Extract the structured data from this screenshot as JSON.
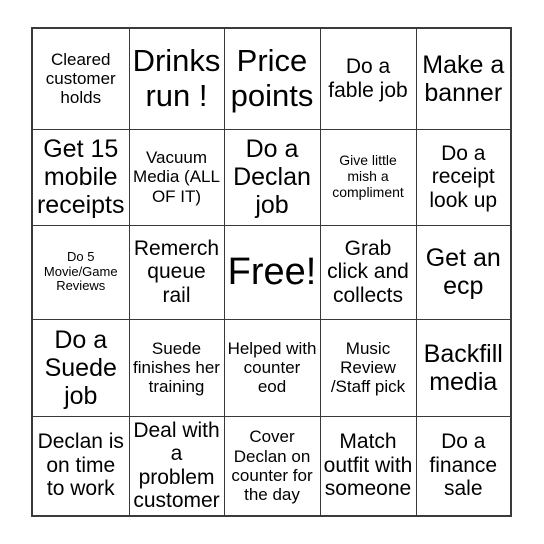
{
  "card": {
    "type": "bingo-card",
    "rows": 5,
    "columns": 5,
    "free_space": {
      "row": 2,
      "column": 2,
      "label": "Free!"
    },
    "background_color": "#ffffff",
    "border_color": "#3a3a3a",
    "text_color": "#000000",
    "cells": [
      [
        {
          "text": "Cleared customer holds",
          "size": "sm"
        },
        {
          "text": "Drinks run !",
          "size": "xl"
        },
        {
          "text": "Price points",
          "size": "xl"
        },
        {
          "text": "Do a fable job",
          "size": "md"
        },
        {
          "text": "Make a banner",
          "size": "lg"
        }
      ],
      [
        {
          "text": "Get 15 mobile receipts",
          "size": "lg"
        },
        {
          "text": "Vacuum Media (ALL OF IT)",
          "size": "sm"
        },
        {
          "text": "Do a Declan job",
          "size": "lg"
        },
        {
          "text": "Give little mish a compliment",
          "size": "xs"
        },
        {
          "text": "Do a receipt look up",
          "size": "md"
        }
      ],
      [
        {
          "text": "Do 5 Movie/Game Reviews",
          "size": "xxs"
        },
        {
          "text": "Remerch queue rail",
          "size": "md"
        },
        {
          "text": "Free!",
          "size": "xxl"
        },
        {
          "text": "Grab click and collects",
          "size": "md"
        },
        {
          "text": "Get an ecp",
          "size": "lg"
        }
      ],
      [
        {
          "text": "Do a Suede job",
          "size": "lg"
        },
        {
          "text": "Suede finishes her training",
          "size": "sm"
        },
        {
          "text": "Helped with counter eod",
          "size": "sm"
        },
        {
          "text": "Music Review /Staff pick",
          "size": "sm"
        },
        {
          "text": "Backfill media",
          "size": "lg"
        }
      ],
      [
        {
          "text": "Declan is on time to work",
          "size": "md"
        },
        {
          "text": "Deal with a problem customer",
          "size": "md"
        },
        {
          "text": "Cover Declan on counter for the day",
          "size": "sm"
        },
        {
          "text": "Match outfit with someone",
          "size": "md"
        },
        {
          "text": "Do a finance sale",
          "size": "md"
        }
      ]
    ]
  }
}
